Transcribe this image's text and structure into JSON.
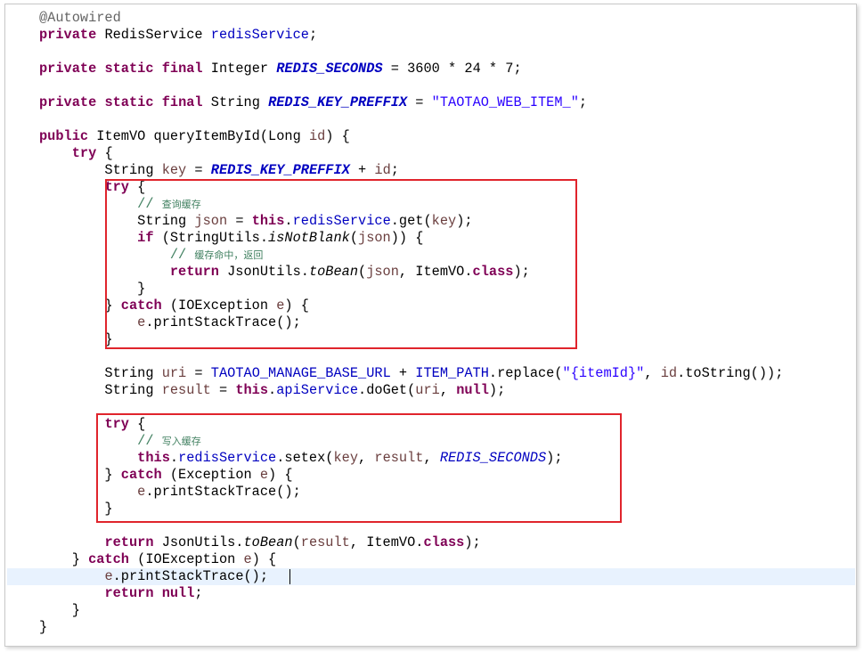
{
  "editor": {
    "lines": [
      [
        {
          "t": "@Autowired",
          "c": "ann"
        }
      ],
      [
        {
          "t": "private",
          "c": "kw"
        },
        {
          "t": " RedisService "
        },
        {
          "t": "redisService",
          "c": "fld"
        },
        {
          "t": ";"
        }
      ],
      [],
      [
        {
          "t": "private",
          "c": "kw"
        },
        {
          "t": " "
        },
        {
          "t": "static",
          "c": "kw"
        },
        {
          "t": " "
        },
        {
          "t": "final",
          "c": "kw"
        },
        {
          "t": " Integer "
        },
        {
          "t": "REDIS_SECONDS",
          "c": "sfldb"
        },
        {
          "t": " = 3600 * 24 * 7;"
        }
      ],
      [],
      [
        {
          "t": "private",
          "c": "kw"
        },
        {
          "t": " "
        },
        {
          "t": "static",
          "c": "kw"
        },
        {
          "t": " "
        },
        {
          "t": "final",
          "c": "kw"
        },
        {
          "t": " String "
        },
        {
          "t": "REDIS_KEY_PREFFIX",
          "c": "sfldb"
        },
        {
          "t": " = "
        },
        {
          "t": "\"TAOTAO_WEB_ITEM_\"",
          "c": "str"
        },
        {
          "t": ";"
        }
      ],
      [],
      [
        {
          "t": "public",
          "c": "kw"
        },
        {
          "t": " ItemVO queryItemById(Long "
        },
        {
          "t": "id",
          "c": "var"
        },
        {
          "t": ") {"
        }
      ],
      [
        {
          "t": "    "
        },
        {
          "t": "try",
          "c": "kw"
        },
        {
          "t": " {"
        }
      ],
      [
        {
          "t": "        String "
        },
        {
          "t": "key",
          "c": "var"
        },
        {
          "t": " = "
        },
        {
          "t": "REDIS_KEY_PREFFIX",
          "c": "sfldb"
        },
        {
          "t": " + "
        },
        {
          "t": "id",
          "c": "var"
        },
        {
          "t": ";"
        }
      ],
      [
        {
          "t": "        "
        },
        {
          "t": "try",
          "c": "kw"
        },
        {
          "t": " {"
        }
      ],
      [
        {
          "t": "            "
        },
        {
          "t": "// ",
          "c": "cmt"
        },
        {
          "t": "查询缓存",
          "c": "cmt cmtcn"
        }
      ],
      [
        {
          "t": "            String "
        },
        {
          "t": "json",
          "c": "var"
        },
        {
          "t": " = "
        },
        {
          "t": "this",
          "c": "kw"
        },
        {
          "t": "."
        },
        {
          "t": "redisService",
          "c": "fld"
        },
        {
          "t": ".get("
        },
        {
          "t": "key",
          "c": "var"
        },
        {
          "t": ");"
        }
      ],
      [
        {
          "t": "            "
        },
        {
          "t": "if",
          "c": "kw"
        },
        {
          "t": " (StringUtils."
        },
        {
          "t": "isNotBlank",
          "c": "smeth"
        },
        {
          "t": "("
        },
        {
          "t": "json",
          "c": "var"
        },
        {
          "t": ")) {"
        }
      ],
      [
        {
          "t": "                "
        },
        {
          "t": "// ",
          "c": "cmt"
        },
        {
          "t": "缓存命中，返回",
          "c": "cmt cmtcn"
        }
      ],
      [
        {
          "t": "                "
        },
        {
          "t": "return",
          "c": "kw"
        },
        {
          "t": " JsonUtils."
        },
        {
          "t": "toBean",
          "c": "smeth"
        },
        {
          "t": "("
        },
        {
          "t": "json",
          "c": "var"
        },
        {
          "t": ", ItemVO."
        },
        {
          "t": "class",
          "c": "kw"
        },
        {
          "t": ");"
        }
      ],
      [
        {
          "t": "            }"
        }
      ],
      [
        {
          "t": "        } "
        },
        {
          "t": "catch",
          "c": "kw"
        },
        {
          "t": " (IOException "
        },
        {
          "t": "e",
          "c": "var"
        },
        {
          "t": ") {"
        }
      ],
      [
        {
          "t": "            "
        },
        {
          "t": "e",
          "c": "var"
        },
        {
          "t": ".printStackTrace();"
        }
      ],
      [
        {
          "t": "        }"
        }
      ],
      [],
      [
        {
          "t": "        String "
        },
        {
          "t": "uri",
          "c": "var"
        },
        {
          "t": " = "
        },
        {
          "t": "TAOTAO_MANAGE_BASE_URL",
          "c": "fld"
        },
        {
          "t": " + "
        },
        {
          "t": "ITEM_PATH",
          "c": "fld"
        },
        {
          "t": ".replace("
        },
        {
          "t": "\"{itemId}\"",
          "c": "str"
        },
        {
          "t": ", "
        },
        {
          "t": "id",
          "c": "var"
        },
        {
          "t": ".toString());"
        }
      ],
      [
        {
          "t": "        String "
        },
        {
          "t": "result",
          "c": "var"
        },
        {
          "t": " = "
        },
        {
          "t": "this",
          "c": "kw"
        },
        {
          "t": "."
        },
        {
          "t": "apiService",
          "c": "fld"
        },
        {
          "t": ".doGet("
        },
        {
          "t": "uri",
          "c": "var"
        },
        {
          "t": ", "
        },
        {
          "t": "null",
          "c": "kw"
        },
        {
          "t": ");"
        }
      ],
      [],
      [
        {
          "t": "        "
        },
        {
          "t": "try",
          "c": "kw"
        },
        {
          "t": " {"
        }
      ],
      [
        {
          "t": "            "
        },
        {
          "t": "// ",
          "c": "cmt"
        },
        {
          "t": "写入缓存",
          "c": "cmt cmtcn"
        }
      ],
      [
        {
          "t": "            "
        },
        {
          "t": "this",
          "c": "kw"
        },
        {
          "t": "."
        },
        {
          "t": "redisService",
          "c": "fld"
        },
        {
          "t": ".setex("
        },
        {
          "t": "key",
          "c": "var"
        },
        {
          "t": ", "
        },
        {
          "t": "result",
          "c": "var"
        },
        {
          "t": ", "
        },
        {
          "t": "REDIS_SECONDS",
          "c": "sfld"
        },
        {
          "t": ");"
        }
      ],
      [
        {
          "t": "        } "
        },
        {
          "t": "catch",
          "c": "kw"
        },
        {
          "t": " (Exception "
        },
        {
          "t": "e",
          "c": "var"
        },
        {
          "t": ") {"
        }
      ],
      [
        {
          "t": "            "
        },
        {
          "t": "e",
          "c": "var"
        },
        {
          "t": ".printStackTrace();"
        }
      ],
      [
        {
          "t": "        }"
        }
      ],
      [],
      [
        {
          "t": "        "
        },
        {
          "t": "return",
          "c": "kw"
        },
        {
          "t": " JsonUtils."
        },
        {
          "t": "toBean",
          "c": "smeth"
        },
        {
          "t": "("
        },
        {
          "t": "result",
          "c": "var"
        },
        {
          "t": ", ItemVO."
        },
        {
          "t": "class",
          "c": "kw"
        },
        {
          "t": ");"
        }
      ],
      [
        {
          "t": "    } "
        },
        {
          "t": "catch",
          "c": "kw"
        },
        {
          "t": " (IOException "
        },
        {
          "t": "e",
          "c": "var"
        },
        {
          "t": ") {"
        }
      ],
      [
        {
          "t": "        "
        },
        {
          "t": "e",
          "c": "var"
        },
        {
          "t": ".printStackTrace();"
        }
      ],
      [
        {
          "t": "        "
        },
        {
          "t": "return",
          "c": "kw"
        },
        {
          "t": " "
        },
        {
          "t": "null",
          "c": "kw"
        },
        {
          "t": ";"
        }
      ],
      [
        {
          "t": "    }"
        }
      ],
      [
        {
          "t": "}"
        }
      ]
    ],
    "current_line": 34,
    "colors": {
      "keyword": "#7f0055",
      "annotation": "#646464",
      "field": "#0000c0",
      "string": "#2a00ff",
      "comment": "#3f7f5f",
      "local_variable": "#6a3e3e",
      "current_line_highlight": "#e8f2fe",
      "callout_border": "#e0242c"
    }
  }
}
